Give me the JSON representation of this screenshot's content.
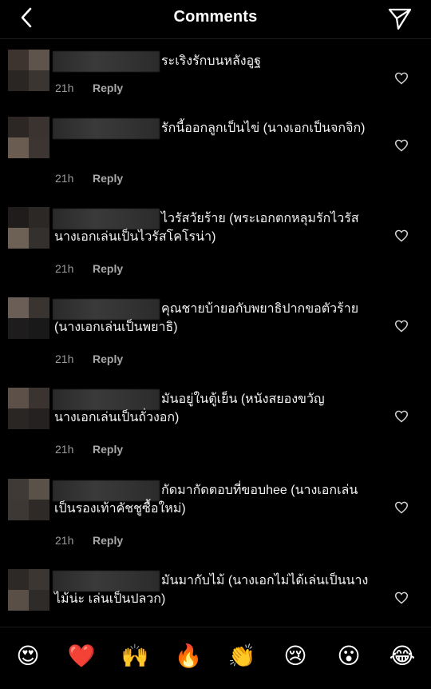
{
  "header": {
    "title": "Comments",
    "back_icon": "chevron-left-icon",
    "share_icon": "paper-plane-icon"
  },
  "comments": [
    {
      "text": "ระเริงรักบนหลังอูฐ",
      "time": "21h",
      "reply": "Reply"
    },
    {
      "text": "รักนี้ออกลูกเป็นไข่ (นางเอกเป็นจกจิก)",
      "time": "21h",
      "reply": "Reply"
    },
    {
      "text": "ไวรัสวัยร้าย (พระเอกตกหลุมรักไวรัส นางเอกเล่นเป็นไวรัสโคโรน่า)",
      "time": "21h",
      "reply": "Reply"
    },
    {
      "text": "คุณชายบ้ายอกับพยาธิปากขอตัวร้าย (นางเอกเล่นเป็นพยาธิ)",
      "time": "21h",
      "reply": "Reply"
    },
    {
      "text": "มันอยู่ในตู้เย็น (หนังสยองขวัญ นางเอกเล่นเป็นถั่วงอก)",
      "time": "21h",
      "reply": "Reply"
    },
    {
      "text": "กัดมากัดตอบที่ขอบhee (นางเอกเล่นเป็นรองเท้าคัชชูซื้อใหม่)",
      "time": "21h",
      "reply": "Reply"
    },
    {
      "text": "มันมากับไม้ (นางเอกไม่ได้เล่นเป็นนางไม้น่ะ เล่นเป็นปลวก)",
      "time": "",
      "reply": ""
    }
  ],
  "emoji_bar": [
    {
      "name": "heart-eyes-emoji",
      "char": "😍"
    },
    {
      "name": "red-heart-emoji",
      "char": "❤️"
    },
    {
      "name": "raising-hands-emoji",
      "char": "🙌"
    },
    {
      "name": "fire-emoji",
      "char": "🔥"
    },
    {
      "name": "clapping-hands-emoji",
      "char": "👏"
    },
    {
      "name": "crying-face-emoji",
      "char": "😢"
    },
    {
      "name": "surprised-face-emoji",
      "char": "😮"
    },
    {
      "name": "tears-of-joy-emoji",
      "char": "😂"
    }
  ],
  "colors": {
    "background": "#000000",
    "text": "#f2f2f2",
    "meta": "#9a9a9a",
    "heart_outline": "#d8d8d8"
  }
}
